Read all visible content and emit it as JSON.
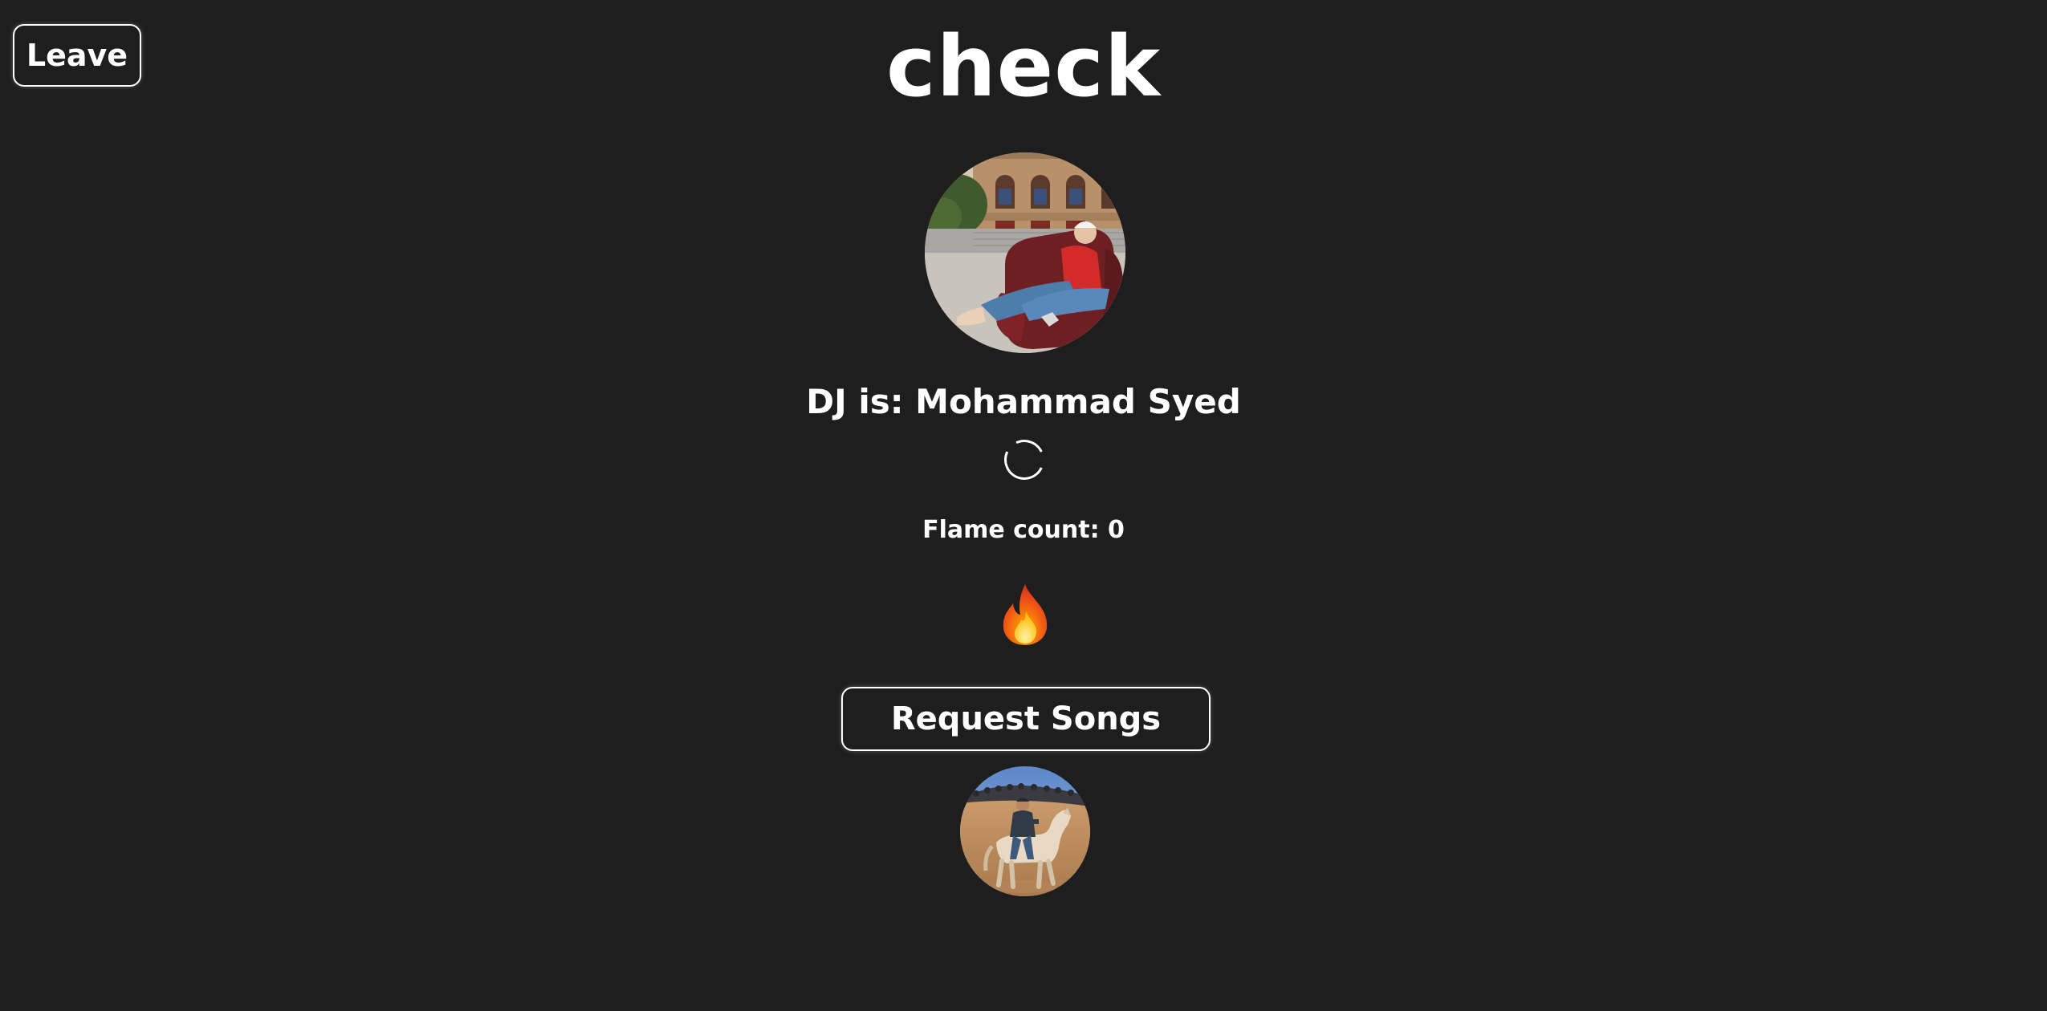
{
  "header": {
    "leave_label": "Leave",
    "room_title": "check"
  },
  "dj": {
    "label": "DJ is: Mohammad Syed",
    "avatar_icon": "dj-avatar-photo"
  },
  "flames": {
    "count_label": "Flame count: 0",
    "icon": "fire-icon"
  },
  "actions": {
    "request_songs_label": "Request Songs"
  },
  "listeners": {
    "avatar_icon": "listener-avatar-photo"
  },
  "colors": {
    "background": "#1e1e1e",
    "text": "#ffffff",
    "border": "#ffffff"
  }
}
